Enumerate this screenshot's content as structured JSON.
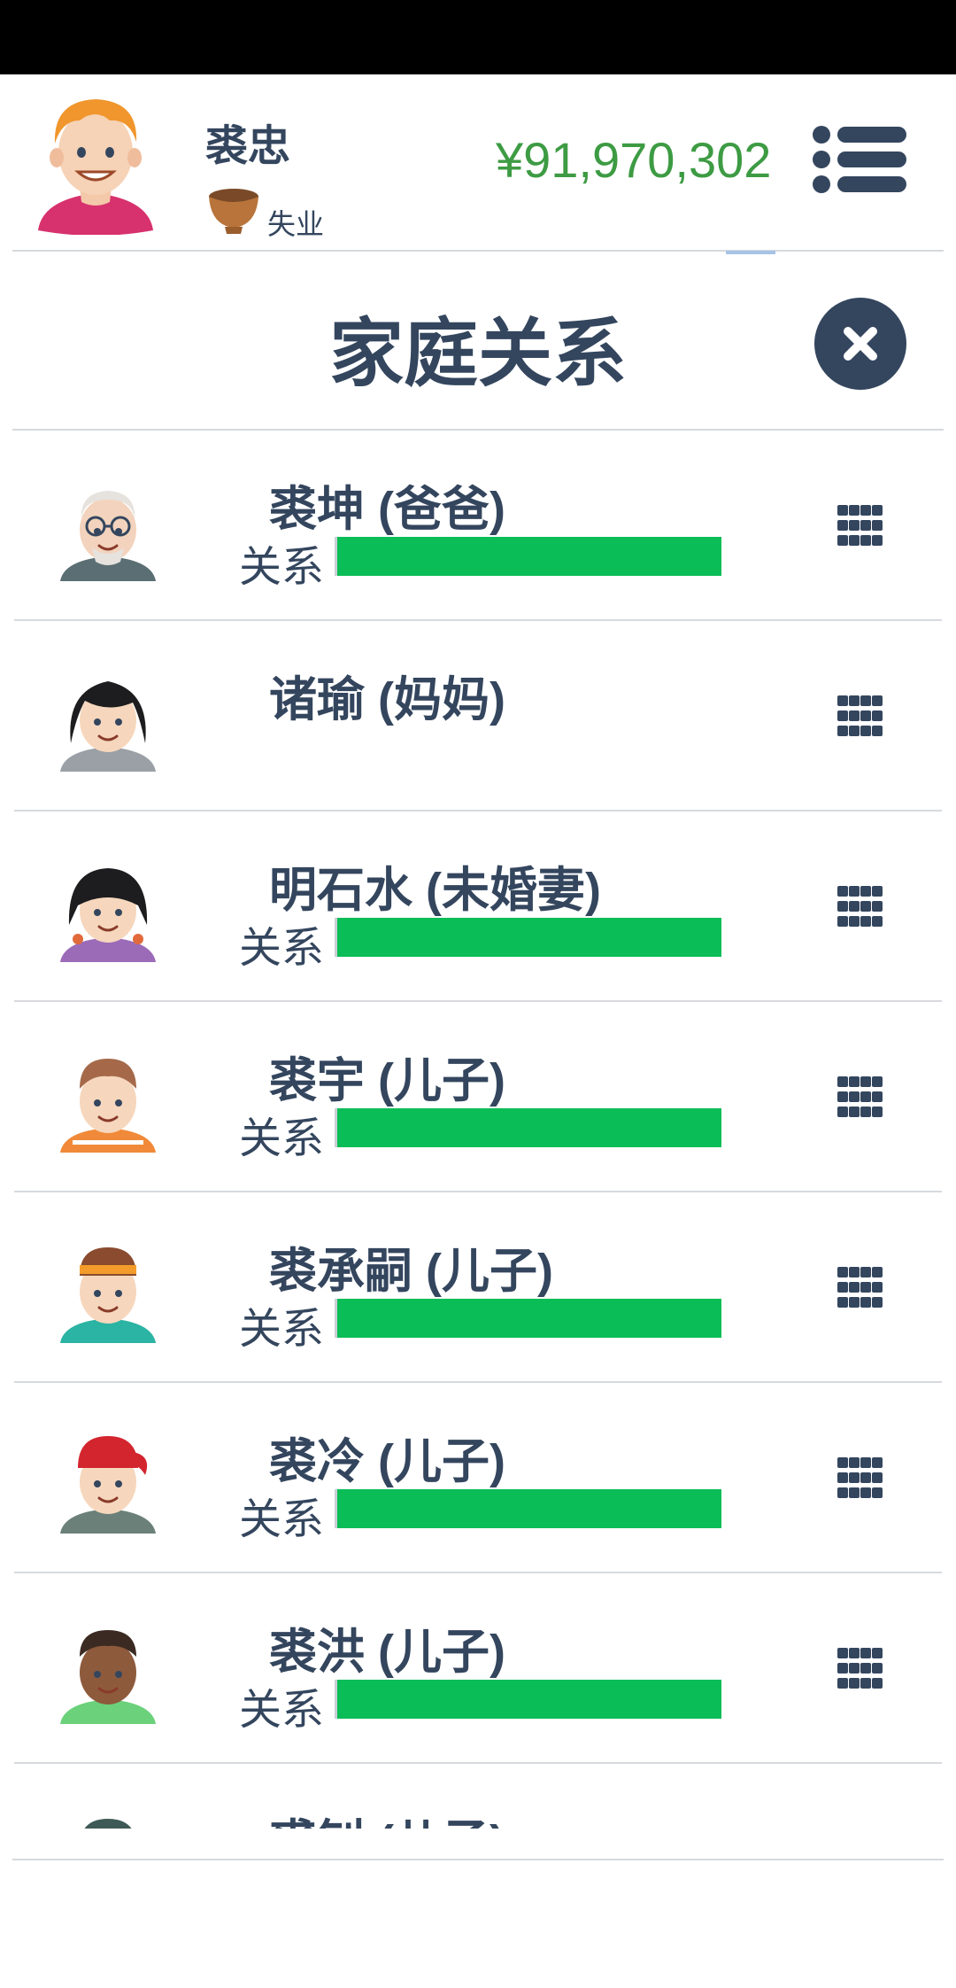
{
  "header": {
    "player_name": "裘忠",
    "job": "失业",
    "money": "¥91,970,302"
  },
  "dialog": {
    "title": "家庭关系"
  },
  "relation_label": "关系",
  "members": [
    {
      "name": "裘坤 (爸爸)",
      "has_relation": true,
      "relation": 1.0,
      "avatar": "elderly-man-avatar"
    },
    {
      "name": "诸瑜 (妈妈)",
      "has_relation": false,
      "relation": null,
      "avatar": "woman-avatar"
    },
    {
      "name": "明石水 (未婚妻)",
      "has_relation": true,
      "relation": 1.0,
      "avatar": "girl-avatar"
    },
    {
      "name": "裘宇 (儿子)",
      "has_relation": true,
      "relation": 1.0,
      "avatar": "boy-striped-shirt-avatar"
    },
    {
      "name": "裘承嗣 (儿子)",
      "has_relation": true,
      "relation": 1.0,
      "avatar": "boy-headband-avatar"
    },
    {
      "name": "裘冷 (儿子)",
      "has_relation": true,
      "relation": 1.0,
      "avatar": "boy-red-cap-avatar"
    },
    {
      "name": "裘洪 (儿子)",
      "has_relation": true,
      "relation": 1.0,
      "avatar": "boy-dark-skin-avatar"
    },
    {
      "name": "裘钊 (儿子)",
      "has_relation": false,
      "relation": null,
      "avatar": "boy-avatar"
    }
  ],
  "colors": {
    "primary": "#34465e",
    "money": "#3d9b43",
    "relation_bar": "#0bbd56"
  }
}
